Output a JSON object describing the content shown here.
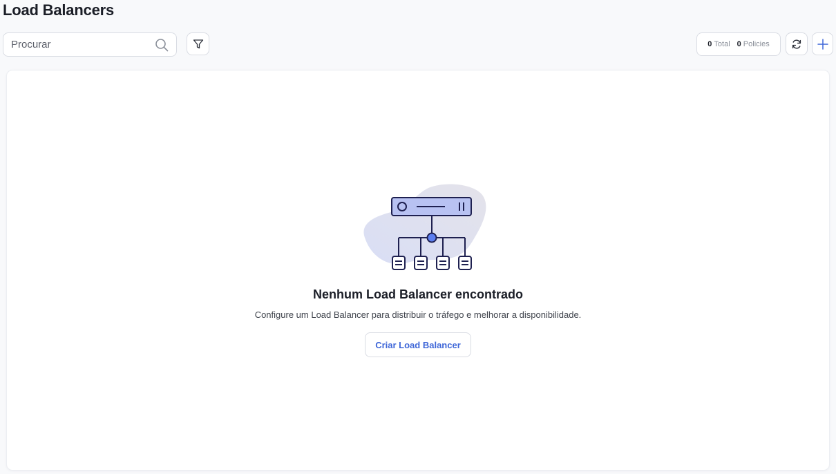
{
  "header": {
    "title": "Load Balancers"
  },
  "toolbar": {
    "search_placeholder": "Procurar",
    "counters": {
      "total_value": "0",
      "total_label": "Total",
      "policies_value": "0",
      "policies_label": "Policies"
    }
  },
  "icons": {
    "search": "search-icon",
    "filter": "filter-icon",
    "refresh": "refresh-icon",
    "add": "plus-icon"
  },
  "empty_state": {
    "title": "Nenhum Load Balancer encontrado",
    "description": "Configure um Load Balancer para distribuir o tráfego e melhorar a disponibilidade.",
    "button_label": "Criar Load Balancer",
    "illustration": "load-balancer-illustration"
  },
  "colors": {
    "accent": "#3f67d8",
    "illustration_fill": "#b8c2f2",
    "illustration_stroke": "#1e2050"
  }
}
